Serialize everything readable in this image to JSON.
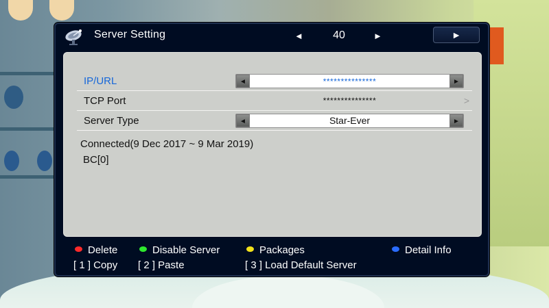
{
  "header": {
    "title": "Server Setting",
    "channel_left_arrow": "◄",
    "channel_number": "40",
    "channel_right_arrow": "►",
    "play_glyph": "►"
  },
  "rows": [
    {
      "label": "IP/URL",
      "value": "***************",
      "control": "selector"
    },
    {
      "label": "TCP Port",
      "value": "***************",
      "control": "submenu",
      "chevron": ">"
    },
    {
      "label": "Server Type",
      "value": "Star-Ever",
      "control": "selector"
    }
  ],
  "selector_arrows": {
    "left": "◄",
    "right": "►"
  },
  "info": {
    "connection": "Connected(9 Dec 2017 ~ 9 Mar 2019)",
    "bc": "BC[0]"
  },
  "legend": {
    "red": {
      "label": "Delete",
      "color": "#ff2a2a"
    },
    "green": {
      "label": "Disable Server",
      "color": "#2ee82e"
    },
    "yellow": {
      "label": "Packages",
      "color": "#f2e21a"
    },
    "blue": {
      "label": "Detail Info",
      "color": "#2a6cff"
    },
    "key1": "[ 1 ] Copy",
    "key2": "[ 2 ] Paste",
    "key3": "[ 3 ] Load Default Server"
  },
  "icons": {
    "title_icon": "satellite-dish-icon"
  }
}
